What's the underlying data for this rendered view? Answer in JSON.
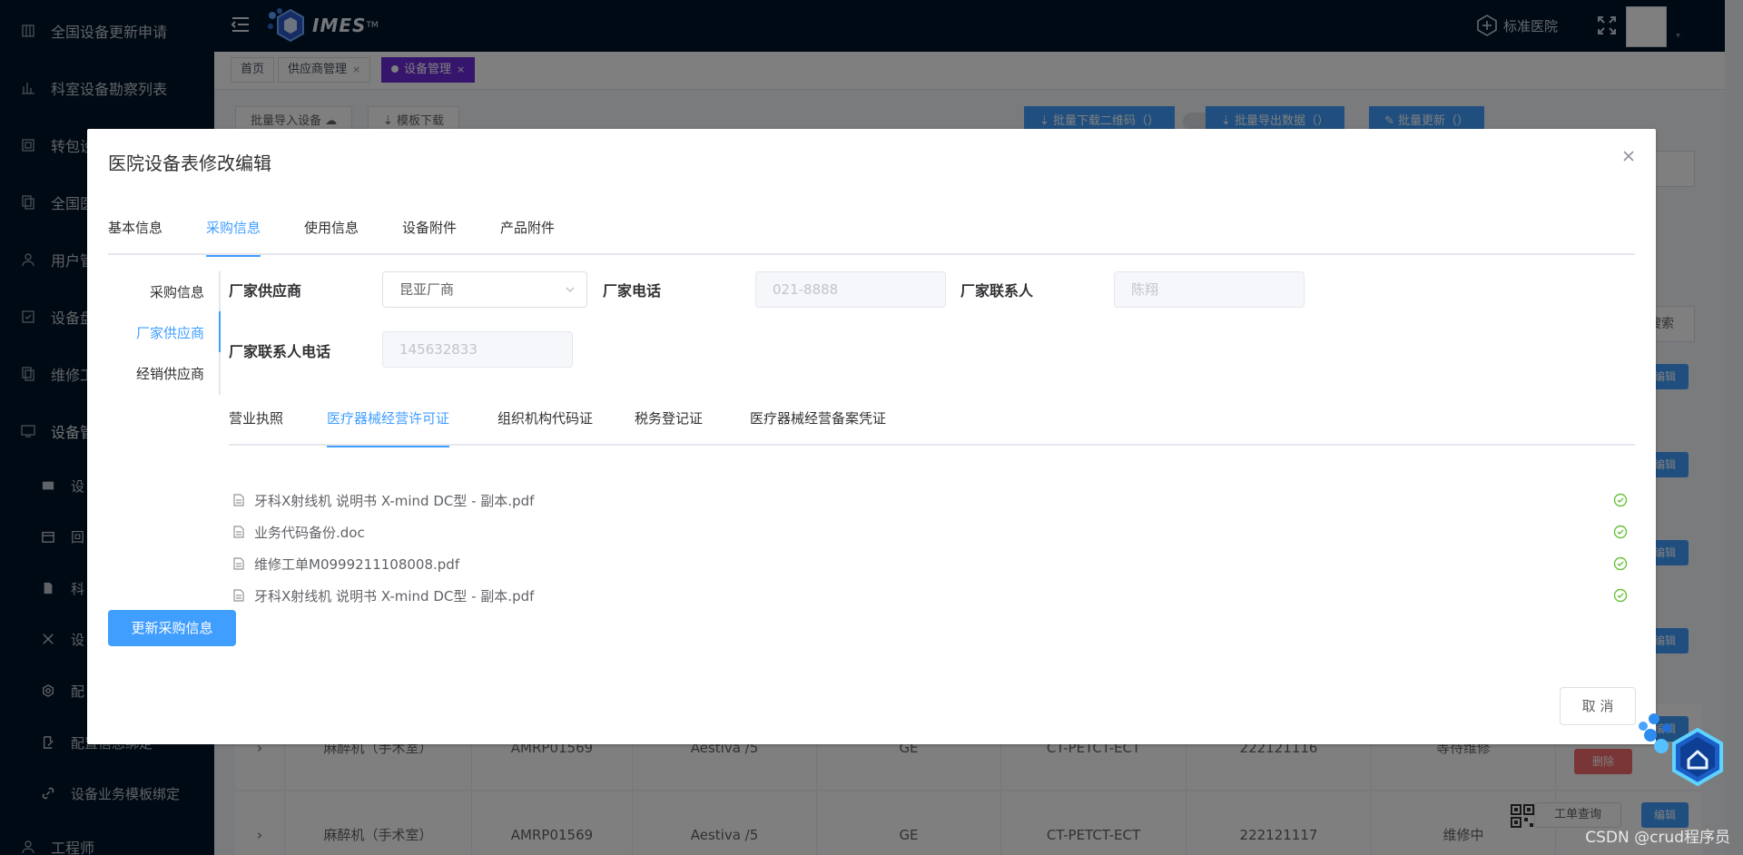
{
  "sidebar": {
    "items": [
      {
        "label": "全国设备更新申请",
        "icon": "building-icon"
      },
      {
        "label": "科室设备勘察列表",
        "icon": "chart-icon"
      },
      {
        "label": "转包设",
        "icon": "box-icon"
      },
      {
        "label": "全国医",
        "icon": "docs-icon"
      },
      {
        "label": "用户管",
        "icon": "user-icon"
      },
      {
        "label": "设备盘",
        "icon": "checkbox-icon"
      },
      {
        "label": "维修工",
        "icon": "wrench-docs-icon"
      },
      {
        "label": "设备管",
        "icon": "device-icon"
      }
    ],
    "sub_items": [
      {
        "label": "设",
        "icon": "screen-icon"
      },
      {
        "label": "回",
        "icon": "calendar-icon"
      },
      {
        "label": "科",
        "icon": "doc-icon"
      },
      {
        "label": "设",
        "icon": "tools-icon"
      },
      {
        "label": "配",
        "icon": "gear-icon"
      },
      {
        "label": "配置信息绑定",
        "icon": "edit-icon"
      },
      {
        "label": "设备业务模板绑定",
        "icon": "link-icon"
      }
    ],
    "bottom": {
      "label": "工程师",
      "icon": "user-icon"
    }
  },
  "header": {
    "logo_text": "IMES",
    "logo_tm": "TM",
    "hospital": "标准医院"
  },
  "tags": [
    {
      "label": "首页",
      "closable": false,
      "active": false
    },
    {
      "label": "供应商管理",
      "closable": true,
      "active": false
    },
    {
      "label": "设备管理",
      "closable": true,
      "active": true
    }
  ],
  "background": {
    "buttons": {
      "import": "批量导入设备",
      "template": "模板下载",
      "qrcode": "批量下载二维码（）",
      "export": "批量导出数据（）",
      "update": "批量更新（）",
      "search": "搜索"
    },
    "rows": [
      {
        "name": "麻醉机（手术室）",
        "code": "AMRP01569",
        "model": "Aestiva /5",
        "brand": "GE",
        "room": "CT-PETCT-ECT",
        "sn": "222121116",
        "status": "等待维修"
      },
      {
        "name": "麻醉机（手术室）",
        "code": "AMRP01569",
        "model": "Aestiva /5",
        "brand": "GE",
        "room": "CT-PETCT-ECT",
        "sn": "222121117",
        "status": "维修中"
      }
    ],
    "edit": "编辑",
    "delete": "删除",
    "order_query": "工单查询"
  },
  "dialog": {
    "title": "医院设备表修改编辑",
    "tabs": [
      "基本信息",
      "采购信息",
      "使用信息",
      "设备附件",
      "产品附件"
    ],
    "active_tab": "采购信息",
    "side_menu": [
      "采购信息",
      "厂家供应商",
      "经销供应商"
    ],
    "active_side": "厂家供应商",
    "form": {
      "supplier_label": "厂家供应商",
      "supplier_value": "昆亚厂商",
      "phone_label": "厂家电话",
      "phone_value": "021-8888",
      "contact_label": "厂家联系人",
      "contact_value": "陈翔",
      "contact_phone_label": "厂家联系人电话",
      "contact_phone_value": "145632833"
    },
    "subtabs": [
      "营业执照",
      "医疗器械经营许可证",
      "组织机构代码证",
      "税务登记证",
      "医疗器械经营备案凭证"
    ],
    "active_subtab": "医疗器械经营许可证",
    "files": [
      "牙科X射线机 说明书 X-mind DC型 - 副本.pdf",
      "业务代码备份.doc",
      "维修工单M0999211108008.pdf",
      "牙科X射线机 说明书 X-mind DC型 - 副本.pdf"
    ],
    "update_button": "更新采购信息",
    "cancel_button": "取 消"
  },
  "watermark": "CSDN @crud程序员",
  "colors": {
    "sidebar_bg": "#001529",
    "primary": "#409eff",
    "active_tag": "#6c2bd9",
    "success": "#67c23a",
    "danger": "#f56c6c"
  }
}
